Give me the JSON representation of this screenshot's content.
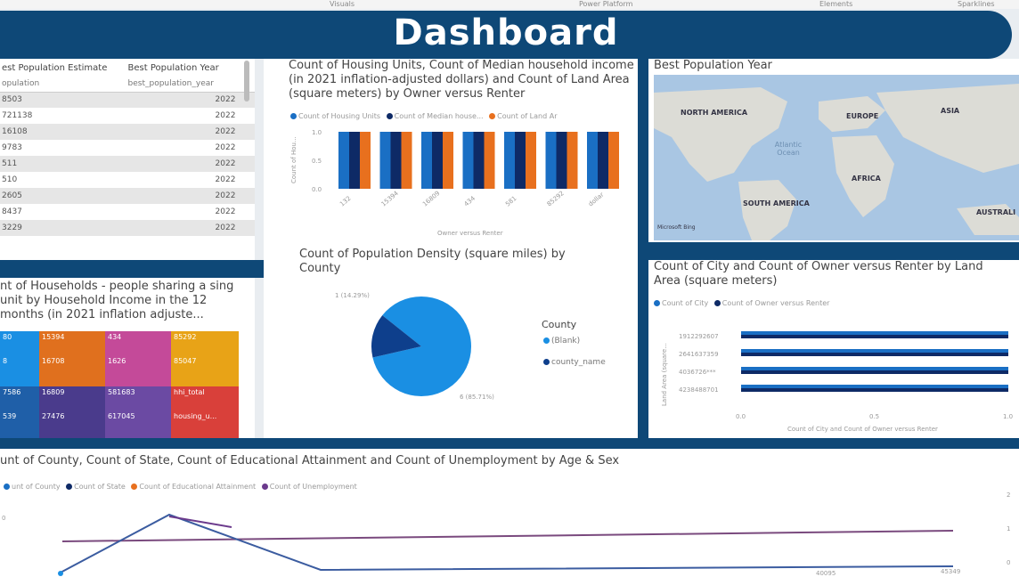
{
  "topbar": {
    "items": [
      "Visuals",
      "Power Platform",
      "Elements",
      "Sparklines"
    ]
  },
  "header": {
    "title": "Dashboard"
  },
  "population_table": {
    "col1_header": "est Population Estimate",
    "col2_header": "Best Population Year",
    "sub1": "opulation",
    "sub2": "best_population_year",
    "rows": [
      [
        "8503",
        "2022"
      ],
      [
        "721138",
        "2022"
      ],
      [
        "16108",
        "2022"
      ],
      [
        "9783",
        "2022"
      ],
      [
        "511",
        "2022"
      ],
      [
        "510",
        "2022"
      ],
      [
        "2605",
        "2022"
      ],
      [
        "8437",
        "2022"
      ],
      [
        "3229",
        "2022"
      ]
    ]
  },
  "housing_chart": {
    "title": "Count of Housing Units, Count of Median household income (in 2021 inflation-adjusted dollars) and Count of Land Area (square meters) by Owner versus Renter",
    "legend": [
      "Count of Housing Units",
      "Count of Median house...",
      "Count of Land Ar"
    ],
    "ylabel": "Count of Hou...",
    "xlabel": "Owner versus Renter",
    "colors": [
      "#1a6fc4",
      "#0e2a66",
      "#e8701e"
    ]
  },
  "map_panel": {
    "title": "Best Population Year",
    "labels": [
      "NORTH AMERICA",
      "EUROPE",
      "ASIA",
      "Atlantic Ocean",
      "AFRICA",
      "SOUTH AMERICA",
      "AUSTRALI"
    ],
    "footer": "Microsoft Bing"
  },
  "households_panel": {
    "title": "nt of Households - people sharing a sing unit by Household Income in the 12 months (in 2021 inflation adjuste...",
    "cells": [
      "80",
      "15394",
      "434",
      "85292",
      "8",
      "16708",
      "1626",
      "85047",
      "7586",
      "16809",
      "581683",
      "hhi_total",
      "539",
      "27476",
      "617045",
      "housing_u..."
    ]
  },
  "pie_panel": {
    "title": "Count of Population Density (square miles) by County",
    "label_small": "1 (14.29%)",
    "label_large": "6 (85.71%)",
    "legend_title": "County",
    "legend": [
      "(Blank)",
      "county_name"
    ],
    "colors": [
      "#1a8fe3",
      "#0e3f8c"
    ]
  },
  "city_panel": {
    "title": "Count of City and Count of Owner versus Renter by Land Area (square meters)",
    "legend": [
      "Count of City",
      "Count of Owner versus Renter"
    ],
    "ylabel": "Land Area (square...",
    "xlabel": "Count of City and Count of Owner versus Renter",
    "colors": [
      "#1a6fc4",
      "#0e2a66"
    ]
  },
  "bottom_panel": {
    "title": "unt of County, Count of State, Count of Educational Attainment and Count of Unemployment by Age & Sex",
    "legend": [
      "unt of County",
      "Count of State",
      "Count of Educational Attainment",
      "Count of Unemployment"
    ],
    "legend_colors": [
      "#1a6fc4",
      "#0e2a66",
      "#e8701e",
      "#6b3a8c"
    ],
    "x_ticks": [
      "40095",
      "45349"
    ]
  },
  "chart_data": [
    {
      "type": "bar",
      "categories": [
        "132",
        "15394",
        "16809",
        "434",
        "581",
        "85292",
        "dollar"
      ],
      "series": [
        {
          "name": "Count of Housing Units",
          "values": [
            1,
            1,
            1,
            1,
            1,
            1,
            1
          ]
        },
        {
          "name": "Count of Median house...",
          "values": [
            1,
            1,
            1,
            1,
            1,
            1,
            1
          ]
        },
        {
          "name": "Count of Land Ar",
          "values": [
            1,
            1,
            1,
            1,
            1,
            1,
            1
          ]
        }
      ],
      "ylim": [
        0,
        1
      ],
      "y_ticks": [
        "1.0",
        "0.5",
        "0.0"
      ],
      "xlabel": "Owner versus Renter",
      "ylabel": "Count of Hou..."
    },
    {
      "type": "pie",
      "categories": [
        "(Blank)",
        "county_name"
      ],
      "values": [
        6,
        1
      ],
      "labels": [
        "6 (85.71%)",
        "1 (14.29%)"
      ]
    },
    {
      "type": "bar",
      "orientation": "horizontal",
      "categories": [
        "1912292607",
        "2641637359",
        "4036726***",
        "4238488701"
      ],
      "series": [
        {
          "name": "Count of City",
          "values": [
            1,
            1,
            1,
            1
          ]
        },
        {
          "name": "Count of Owner versus Renter",
          "values": [
            1,
            1,
            1,
            1
          ]
        }
      ],
      "xlim": [
        0,
        1
      ],
      "x_ticks": [
        "0.0",
        "0.5",
        "1.0"
      ],
      "ylabel": "Land Area (square...",
      "xlabel": "Count of City and Count of Owner versus Renter"
    },
    {
      "type": "line",
      "y_ticks_left": [
        "0"
      ],
      "y_ticks_right": [
        "2",
        "1",
        "0"
      ],
      "x_ticks": [
        "40095",
        "45349"
      ]
    }
  ]
}
